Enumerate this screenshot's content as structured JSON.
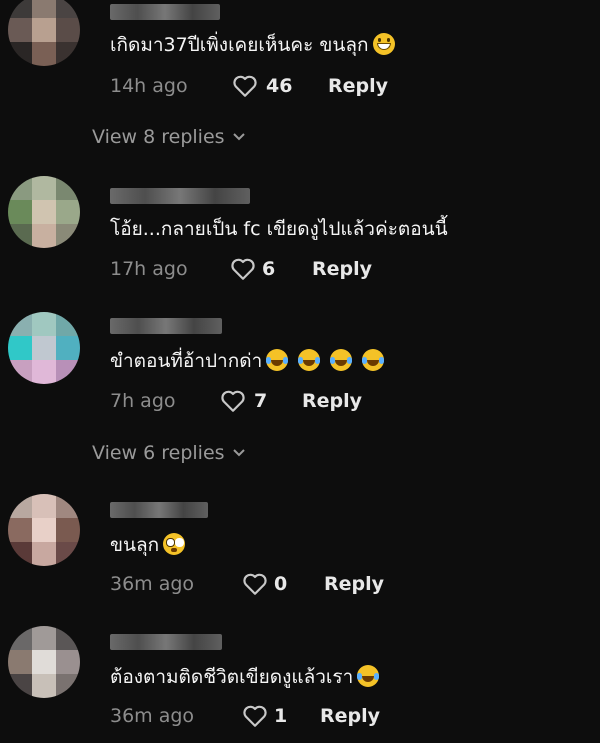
{
  "comments": [
    {
      "text": "เกิดมา37ปีเพิ่งเคยเห็นคะ ขนลุก",
      "emoji": [
        "grinning-face-icon"
      ],
      "time": "14h ago",
      "likes": "46",
      "reply": "Reply"
    },
    {
      "text": "โอ้ย...กลายเป็น fc เขียดงูไปแล้วค่ะตอนนี้",
      "emoji": [],
      "time": "17h ago",
      "likes": "6",
      "reply": "Reply"
    },
    {
      "text": "ขำตอนที่อ้าปากด่า",
      "emoji": [
        "tears-of-joy-icon",
        "tears-of-joy-icon",
        "tears-of-joy-icon",
        "tears-of-joy-icon"
      ],
      "time": "7h ago",
      "likes": "7",
      "reply": "Reply"
    },
    {
      "text": "ขนลุก",
      "emoji": [
        "flushed-face-icon"
      ],
      "time": "36m ago",
      "likes": "0",
      "reply": "Reply"
    },
    {
      "text": "ต้องตามติดชีวิตเขียดงูแล้วเรา",
      "emoji": [
        "tears-of-joy-icon"
      ],
      "time": "36m ago",
      "likes": "1",
      "reply": "Reply"
    }
  ],
  "view_replies": [
    {
      "label": "View 8 replies"
    },
    {
      "label": "View 6 replies"
    }
  ],
  "colors": {
    "background": "#0d0d0d",
    "text": "#f5f5f5",
    "muted": "#8d8d8d"
  }
}
